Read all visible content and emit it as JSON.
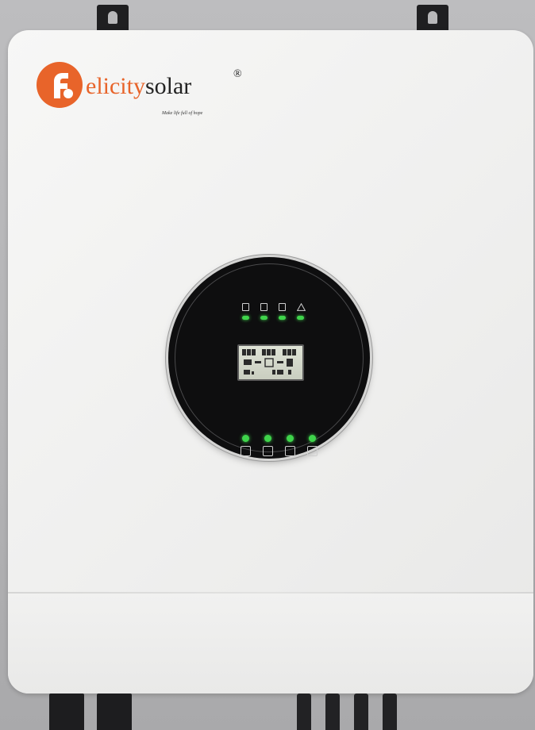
{
  "brand": {
    "logo_letter": "f",
    "name_primary": "elicity",
    "name_secondary": "solar",
    "registered": "®",
    "tagline": "Make life full of hope"
  },
  "colors": {
    "brand_orange": "#e8642a",
    "panel_black": "#0e0e0f",
    "led_green": "#3fd44b",
    "lcd_background": "#cfd4c6",
    "housing_white": "#f2f2f1",
    "wall_grey": "#b5b5b7"
  },
  "indicators": [
    {
      "icon": "battery-status-icon"
    },
    {
      "icon": "solar-panel-icon"
    },
    {
      "icon": "grid-status-icon"
    },
    {
      "icon": "warning-icon"
    }
  ],
  "buttons": [
    {
      "icon": "enter-button-icon"
    },
    {
      "icon": "up-button-icon"
    },
    {
      "icon": "down-button-icon"
    },
    {
      "icon": "escape-button-icon"
    }
  ]
}
